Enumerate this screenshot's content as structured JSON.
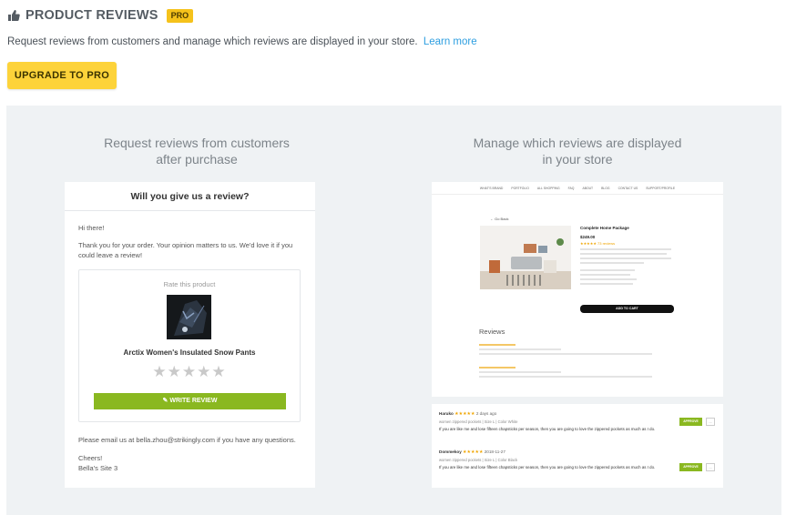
{
  "header": {
    "title": "PRODUCT REVIEWS",
    "badge": "PRO",
    "description": "Request reviews from customers and manage which reviews are displayed in your store.",
    "learn_more": "Learn more",
    "upgrade_label": "UPGRADE TO PRO"
  },
  "left": {
    "title_line1": "Request reviews from customers",
    "title_line2": "after purchase",
    "email": {
      "title": "Will you give us a review?",
      "greeting": "Hi there!",
      "message": "Thank you for your order. Your opinion matters to us. We'd love it if you could leave a review!",
      "rate_label": "Rate this product",
      "product_name": "Arctix Women's Insulated Snow Pants",
      "stars": "★★★★★",
      "write_review": "✎ WRITE REVIEW",
      "contact": "Please email us at bella.zhou@strikingly.com if you have any questions.",
      "signoff": "Cheers!",
      "signature": "Bella's Site 3"
    }
  },
  "right": {
    "title_line1": "Manage which reviews are displayed",
    "title_line2": "in your store",
    "store": {
      "nav": [
        "WHAT'S BRAND",
        "PORTFOLIO",
        "ALL SHOPPING",
        "FAQ",
        "ABOUT",
        "BLOG",
        "CONTACT US",
        "SUPPORT/PROFILE"
      ],
      "back": "← Go Back",
      "product_title": "Complete Home Package",
      "price": "$249.00",
      "rating": "★★★★★ 73 reviews",
      "add_to_cart": "ADD TO CART",
      "reviews_heading": "Reviews"
    },
    "approvals": [
      {
        "name": "Haruko",
        "stars": "★★★★★",
        "when": "2 days ago",
        "meta": "women zippered pockets  |  Size L  |  Color White",
        "body": "If you are like me and lose fifteen chapsticks per season, then you are going to love the zippered pockets as much as I do.",
        "approve": "APPROVE",
        "more": "..."
      },
      {
        "name": "Dommekoy",
        "stars": "★★★★★",
        "when": "2018-11-27",
        "meta": "women zippered pockets  |  Size L  |  Color Black",
        "body": "If you are like me and lose fifteen chapsticks per season, then you are going to love the zippered pockets as much as I do.",
        "approve": "APPROVE",
        "more": "..."
      }
    ]
  },
  "colors": {
    "accent_yellow": "#fdd33a",
    "accent_green": "#8ab820",
    "link": "#2d9ee0",
    "panel_bg": "#eff2f4"
  }
}
